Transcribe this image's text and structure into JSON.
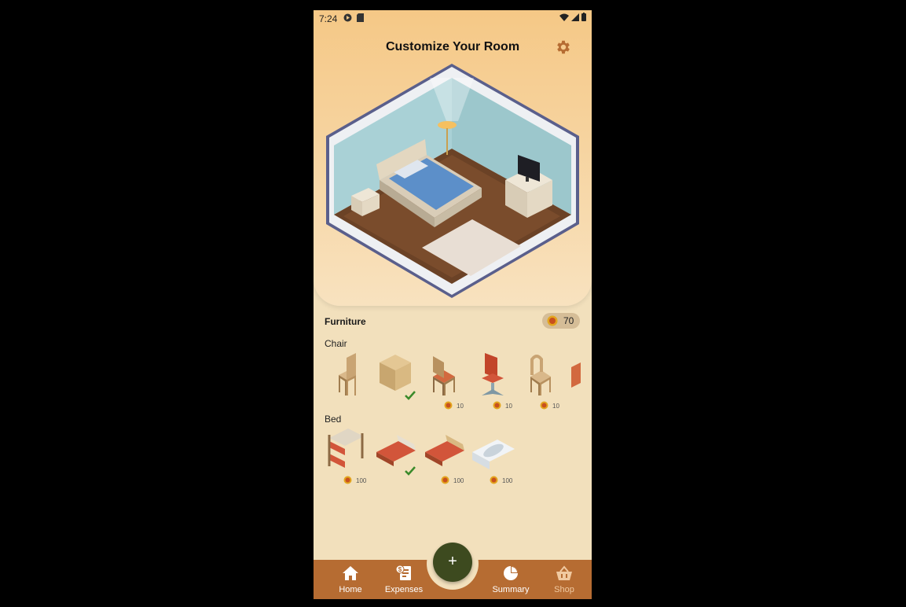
{
  "status_bar": {
    "time": "7:24"
  },
  "header": {
    "title": "Customize Your Room"
  },
  "furniture": {
    "heading": "Furniture",
    "coins": "70",
    "categories": [
      {
        "name": "Chair",
        "items": [
          {
            "price": "",
            "owned": false
          },
          {
            "price": "",
            "owned": true
          },
          {
            "price": "10",
            "owned": false
          },
          {
            "price": "10",
            "owned": false
          },
          {
            "price": "10",
            "owned": false
          }
        ]
      },
      {
        "name": "Bed",
        "items": [
          {
            "price": "100",
            "owned": false
          },
          {
            "price": "",
            "owned": true
          },
          {
            "price": "100",
            "owned": false
          },
          {
            "price": "100",
            "owned": false
          }
        ]
      }
    ]
  },
  "nav": {
    "home": "Home",
    "expenses": "Expenses",
    "add": "+",
    "summary": "Summary",
    "shop": "Shop"
  },
  "colors": {
    "accent": "#b66c32",
    "fab": "#3d4a1f",
    "background": "#f2e0bc"
  }
}
